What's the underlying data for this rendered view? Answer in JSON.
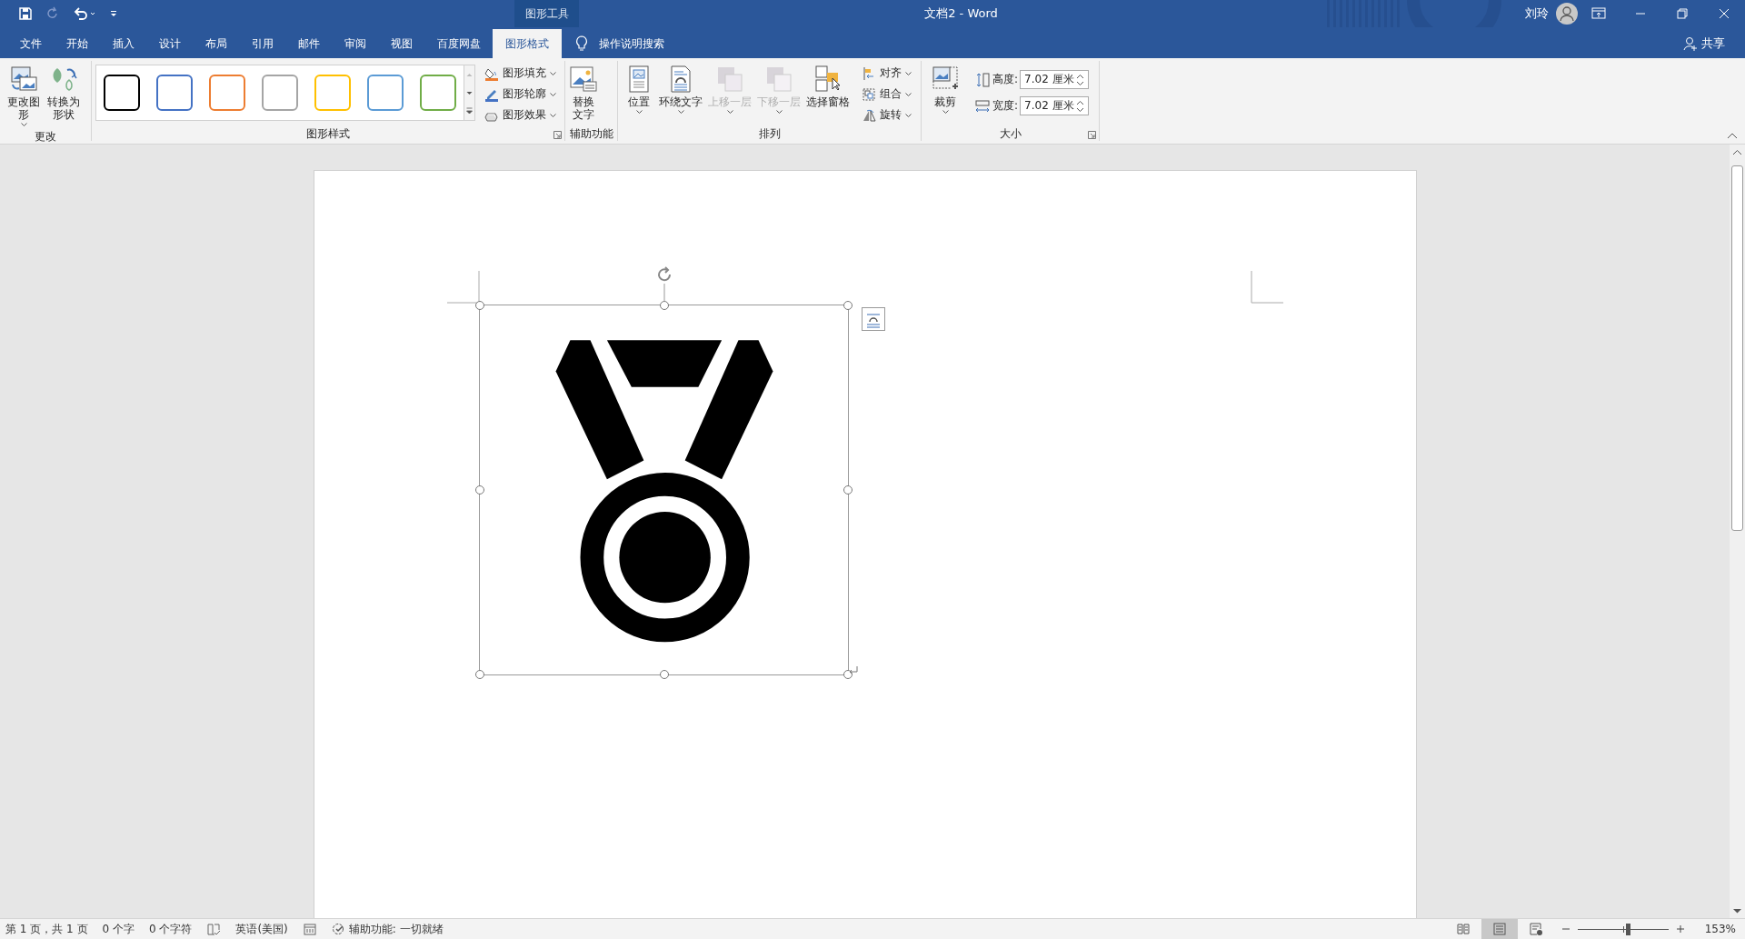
{
  "window": {
    "title": "文档2  -  Word",
    "context_group": "图形工具",
    "user": "刘玲",
    "share": "共享"
  },
  "tabs": [
    {
      "label": "文件",
      "selected": false
    },
    {
      "label": "开始",
      "selected": false
    },
    {
      "label": "插入",
      "selected": false
    },
    {
      "label": "设计",
      "selected": false
    },
    {
      "label": "布局",
      "selected": false
    },
    {
      "label": "引用",
      "selected": false
    },
    {
      "label": "邮件",
      "selected": false
    },
    {
      "label": "审阅",
      "selected": false
    },
    {
      "label": "视图",
      "selected": false
    },
    {
      "label": "百度网盘",
      "selected": false
    },
    {
      "label": "图形格式",
      "selected": true
    }
  ],
  "tell_me": "操作说明搜索",
  "ribbon": {
    "change": {
      "label": "更改",
      "buttons": [
        {
          "kind": "change-shape",
          "label": "更改图形",
          "dropdown": true
        },
        {
          "kind": "convert",
          "label": "转换为形状",
          "dropdown": false
        }
      ]
    },
    "styles": {
      "label": "图形样式",
      "swatches": [
        {
          "color": "#000000"
        },
        {
          "color": "#4472c4"
        },
        {
          "color": "#ed7d31"
        },
        {
          "color": "#a5a5a5"
        },
        {
          "color": "#ffc000"
        },
        {
          "color": "#5b9bd5"
        },
        {
          "color": "#70ad47"
        }
      ],
      "commands": [
        {
          "kind": "fill",
          "label": "图形填充"
        },
        {
          "kind": "outline",
          "label": "图形轮廓"
        },
        {
          "kind": "effects",
          "label": "图形效果"
        }
      ]
    },
    "accessibility": {
      "label": "辅助功能",
      "button": "替换文字"
    },
    "arrange": {
      "label": "排列",
      "buttons": [
        {
          "kind": "position",
          "label": "位置",
          "disabled": false
        },
        {
          "kind": "wrap",
          "label": "环绕文字",
          "disabled": false
        },
        {
          "kind": "forward",
          "label": "上移一层",
          "disabled": true
        },
        {
          "kind": "backward",
          "label": "下移一层",
          "disabled": true
        },
        {
          "kind": "pane",
          "label": "选择窗格",
          "disabled": false
        }
      ],
      "small": [
        {
          "kind": "align",
          "label": "对齐"
        },
        {
          "kind": "group",
          "label": "组合"
        },
        {
          "kind": "rotate",
          "label": "旋转"
        }
      ]
    },
    "size": {
      "label": "大小",
      "crop": "裁剪",
      "fields": [
        {
          "kind": "height",
          "label": "高度:",
          "value": "7.02 厘米"
        },
        {
          "kind": "width",
          "label": "宽度:",
          "value": "7.02 厘米"
        }
      ]
    }
  },
  "status_bar": {
    "page": "第 1 页，共 1 页",
    "words": "0 个字",
    "chars": "0 个字符",
    "language": "英语(美国)",
    "accessibility": "辅助功能: 一切就绪",
    "views": [
      {
        "kind": "read",
        "selected": false
      },
      {
        "kind": "print",
        "selected": true
      },
      {
        "kind": "web",
        "selected": false
      }
    ],
    "zoom": {
      "level": 0.55,
      "reading": "153%"
    }
  }
}
